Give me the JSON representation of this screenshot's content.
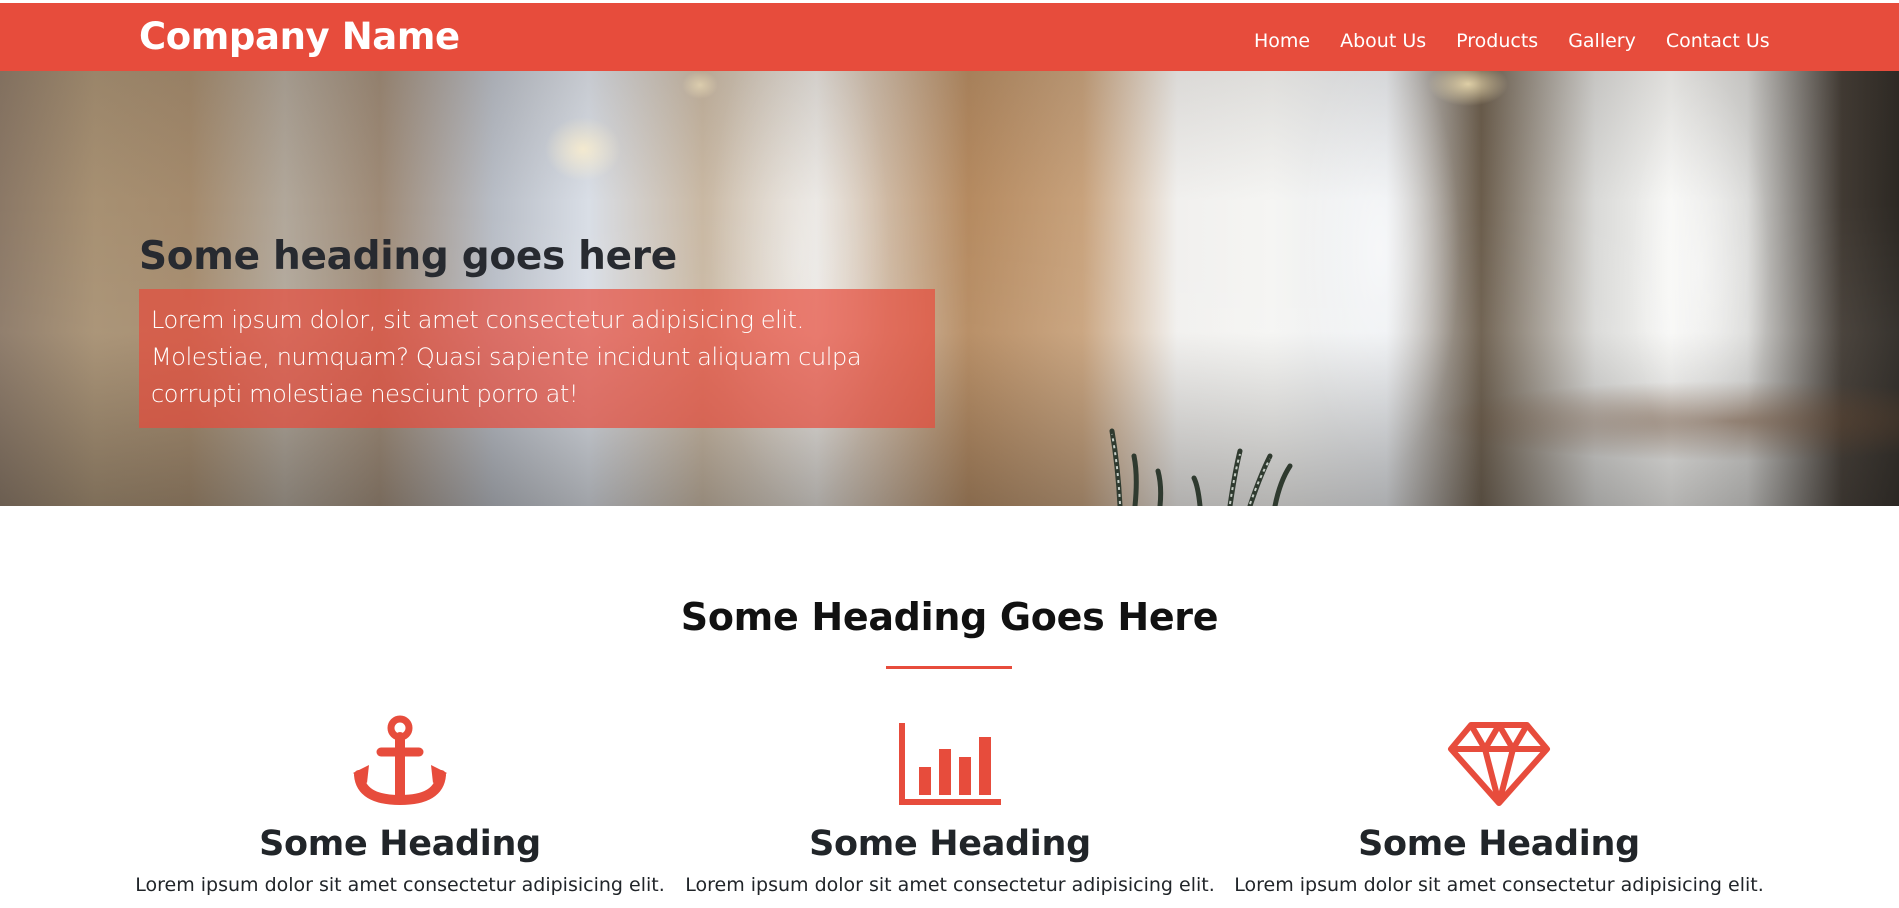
{
  "navbar": {
    "brand": "Company Name",
    "links": [
      {
        "label": "Home"
      },
      {
        "label": "About Us"
      },
      {
        "label": "Products"
      },
      {
        "label": "Gallery"
      },
      {
        "label": "Contact Us"
      }
    ]
  },
  "hero": {
    "heading": "Some heading goes here",
    "text": "Lorem ipsum dolor, sit amet consectetur adipisicing elit. Molestiae, numquam? Quasi sapiente incidunt aliquam culpa corrupti molestiae nesciunt porro at!"
  },
  "features": {
    "heading": "Some Heading Goes Here",
    "items": [
      {
        "icon": "anchor-icon",
        "heading": "Some Heading",
        "text": "Lorem ipsum dolor sit amet consectetur adipisicing elit."
      },
      {
        "icon": "bar-chart-icon",
        "heading": "Some Heading",
        "text": "Lorem ipsum dolor sit amet consectetur adipisicing elit."
      },
      {
        "icon": "diamond-icon",
        "heading": "Some Heading",
        "text": "Lorem ipsum dolor sit amet consectetur adipisicing elit."
      }
    ]
  },
  "colors": {
    "accent": "#e74c3c",
    "hero_box": "rgba(231, 76, 60, 0.70)",
    "text_dark": "#212529",
    "white": "#ffffff"
  }
}
